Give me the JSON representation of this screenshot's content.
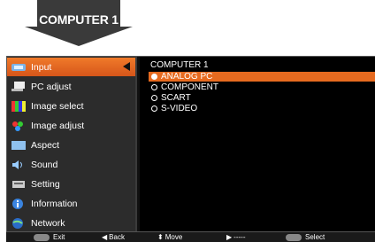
{
  "banner": {
    "label": "COMPUTER 1"
  },
  "sidebar": {
    "items": [
      {
        "label": "Input",
        "icon": "input-icon",
        "active": true
      },
      {
        "label": "PC adjust",
        "icon": "pc-adjust-icon"
      },
      {
        "label": "Image select",
        "icon": "image-select-icon"
      },
      {
        "label": "Image adjust",
        "icon": "image-adjust-icon"
      },
      {
        "label": "Aspect",
        "icon": "aspect-icon"
      },
      {
        "label": "Sound",
        "icon": "sound-icon"
      },
      {
        "label": "Setting",
        "icon": "setting-icon"
      },
      {
        "label": "Information",
        "icon": "information-icon"
      },
      {
        "label": "Network",
        "icon": "network-icon"
      }
    ]
  },
  "panel": {
    "title": "COMPUTER 1",
    "options": [
      {
        "label": "ANALOG PC",
        "selected": true
      },
      {
        "label": "COMPONENT"
      },
      {
        "label": "SCART"
      },
      {
        "label": "S-VIDEO"
      }
    ]
  },
  "hints": {
    "exit": "Exit",
    "back": "Back",
    "move": "Move",
    "next": "-----",
    "select": "Select"
  },
  "colors": {
    "accent": "#e66a1f",
    "panel_bg": "#000000",
    "sidebar_bg": "#2c2c2c"
  }
}
